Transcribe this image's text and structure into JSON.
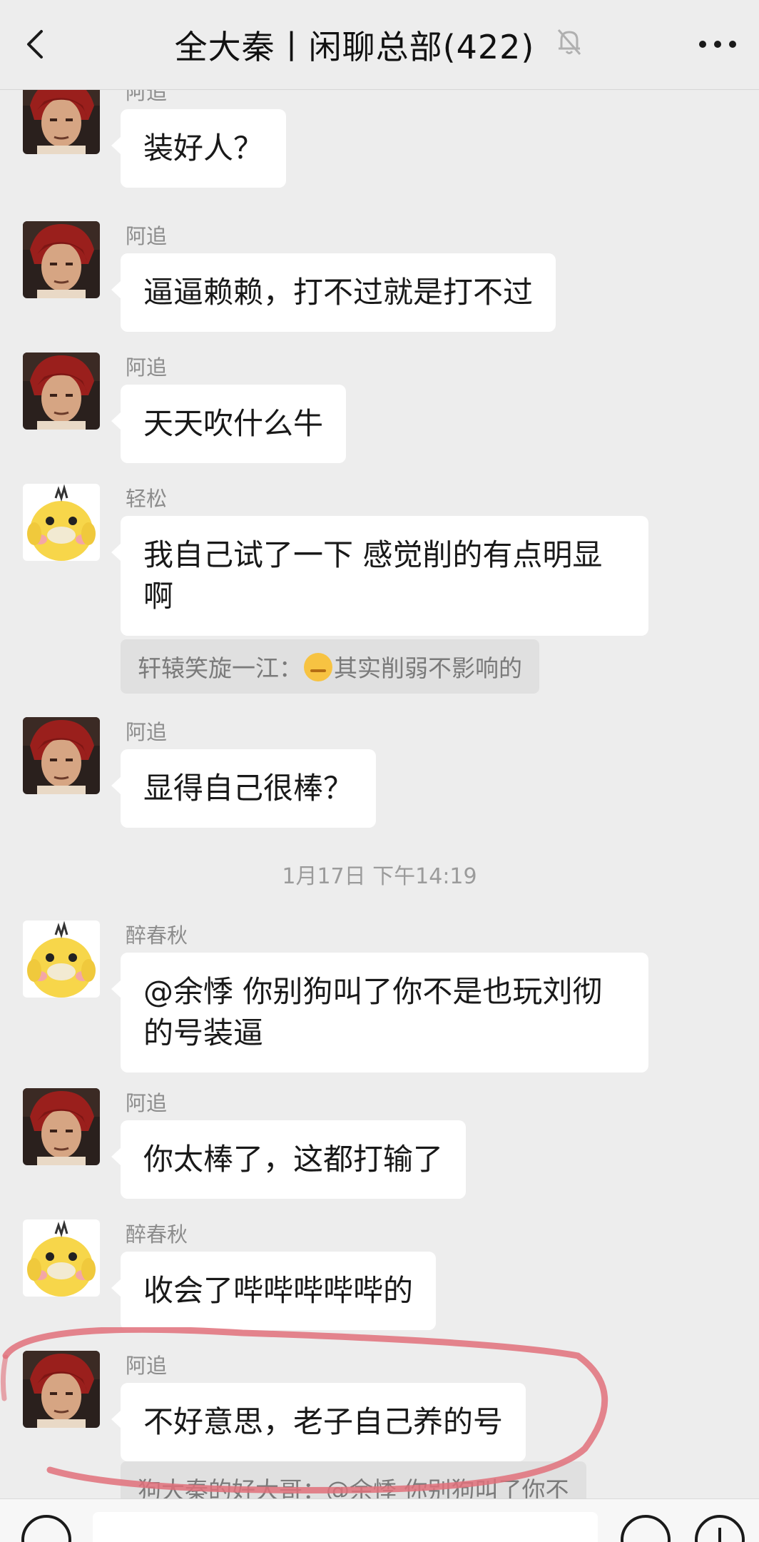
{
  "header": {
    "title": "全大秦丨闲聊总部(422)",
    "back_icon": "chevron-left-icon",
    "mute_icon": "bell-muted-icon",
    "more_icon": "ellipsis-icon"
  },
  "messages": [
    {
      "sender": "阿追",
      "avatar": "red-haired-avatar",
      "text": "装好人？"
    },
    {
      "sender": "阿追",
      "avatar": "red-haired-avatar",
      "text": "逼逼赖赖，打不过就是打不过"
    },
    {
      "sender": "阿追",
      "avatar": "red-haired-avatar",
      "text": "天天吹什么牛"
    },
    {
      "sender": "轻松",
      "avatar": "psyduck-avatar",
      "text": "我自己试了一下 感觉削的有点明显啊",
      "quote": {
        "prefix": "轩辕笑旋一江：",
        "emoji": "sweat-smile-emoji",
        "text": "其实削弱不影响的"
      }
    },
    {
      "sender": "阿追",
      "avatar": "red-haired-avatar",
      "text": "显得自己很棒？"
    },
    {
      "sender": "醉春秋",
      "avatar": "psyduck-avatar",
      "text": "@余悸  你别狗叫了你不是也玩刘彻的号装逼"
    },
    {
      "sender": "阿追",
      "avatar": "red-haired-avatar",
      "text": "你太棒了，这都打输了"
    },
    {
      "sender": "醉春秋",
      "avatar": "psyduck-avatar",
      "text": "收会了哔哔哔哔哔的"
    },
    {
      "sender": "阿追",
      "avatar": "red-haired-avatar",
      "text": "不好意思，老子自己养的号"
    }
  ],
  "timestamp": "1月17日 下午14:19",
  "partial_quote": "狗大秦的好大哥：@余悸  你别狗叫了你不",
  "annotation": {
    "color": "#e0707a"
  },
  "input_bar": {
    "voice_icon": "voice-icon",
    "emoji_icon": "emoji-icon",
    "plus_icon": "plus-icon"
  },
  "colors": {
    "background": "#ededed",
    "bubble": "#ffffff",
    "quote_bg": "#e0e0e0"
  }
}
